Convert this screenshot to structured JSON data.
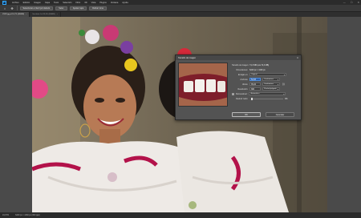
{
  "menubar": {
    "logo": "Ps",
    "items": [
      "Archivo",
      "Edición",
      "Imagen",
      "Capa",
      "Texto",
      "Selección",
      "Filtro",
      "3D",
      "Vista",
      "Plugins",
      "Ventana",
      "Ayuda"
    ]
  },
  "window_controls": [
    "—",
    "☐",
    "✕"
  ],
  "optionsbar": {
    "buttons": [
      "Seleccionar e inferir por defecto",
      "Selec.",
      "Ajustar capa",
      "Refinar zona"
    ]
  },
  "tabs": [
    {
      "label": "XXXX.jpg al 16,7% (RGB/8)",
      "active": true
    },
    {
      "label": "Sin título-1 al 33,3% (RGB/8)",
      "active": false
    }
  ],
  "statusbar": {
    "zoom": "16,67%",
    "info": "6240 px × 4160 px (300 ppp)"
  },
  "dialog": {
    "title": "Tamaño de imagen",
    "close": "✕",
    "image_size_label": "Tamaño de imagen:",
    "image_size_value": "74,3 MB (era 74,3 MB)",
    "dimensions_label": "Dimensiones:",
    "dimensions_value": "6240 px × 4160 px",
    "fit_label": "Encajar en:",
    "fit_value": "Original",
    "width_label": "Anchura:",
    "width_value": "52,83",
    "width_unit": "Centímetros",
    "height_label": "Altura:",
    "height_value": "35,22",
    "height_unit": "Centímetros",
    "resolution_label": "Resolución:",
    "resolution_value": "300",
    "resolution_unit": "Píxeles/pulgada",
    "resample_label": "Remuestrear:",
    "resample_value": "Automático",
    "noise_label": "Reducir ruido:",
    "noise_value": "0%",
    "ok": "OK",
    "cancel": "Cancelar"
  },
  "colors": {
    "accent": "#31a8ff",
    "highlight": "#2b5ea8"
  }
}
